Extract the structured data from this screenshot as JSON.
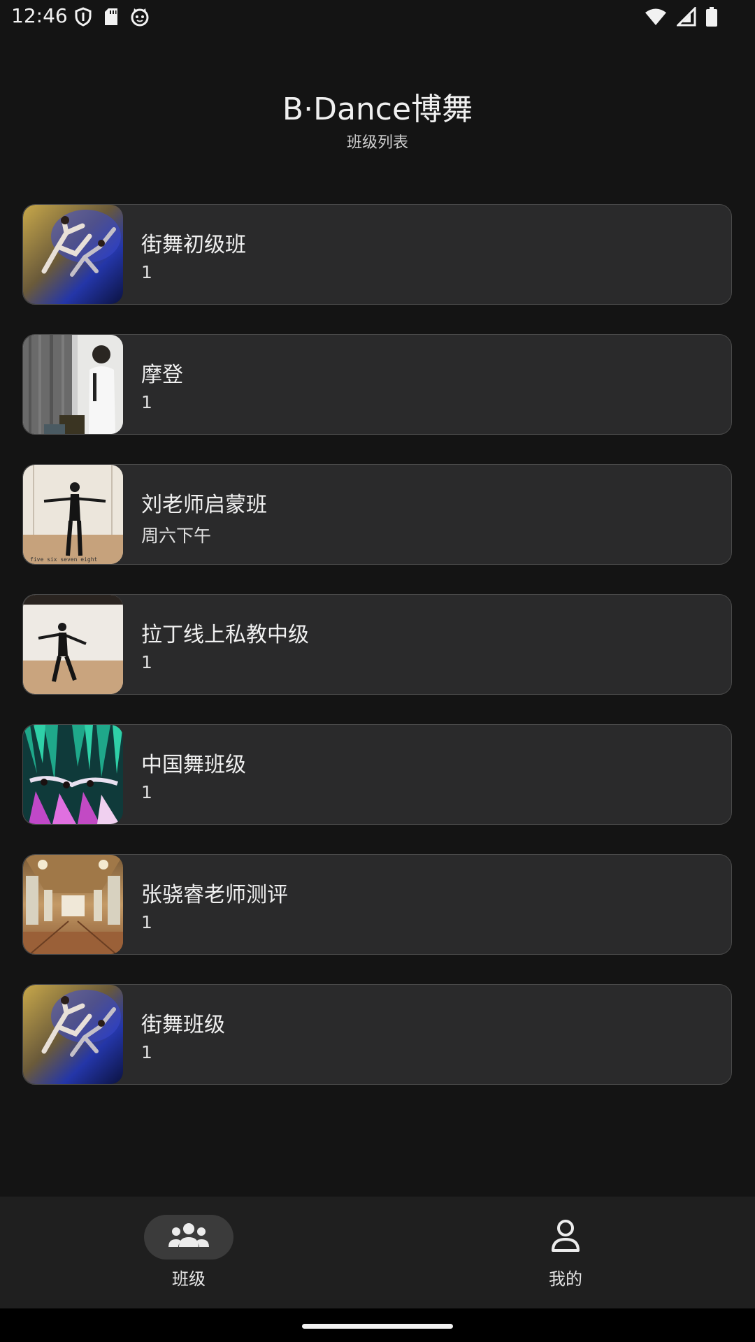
{
  "status_bar": {
    "time": "12:46",
    "left_icons": [
      "shield-icon",
      "sd-card-icon",
      "cat-face-icon"
    ],
    "right_icons": [
      "wifi-icon",
      "signal-icon",
      "battery-icon"
    ]
  },
  "header": {
    "title": "B·Dance博舞",
    "subtitle": "班级列表"
  },
  "classes": [
    {
      "name": "街舞初级班",
      "desc": "1"
    },
    {
      "name": "摩登",
      "desc": "1"
    },
    {
      "name": "刘老师启蒙班",
      "desc": "周六下午"
    },
    {
      "name": "拉丁线上私教中级",
      "desc": "1"
    },
    {
      "name": "中国舞班级",
      "desc": "1"
    },
    {
      "name": "张骁睿老师测评",
      "desc": "1"
    },
    {
      "name": "街舞班级",
      "desc": "1"
    }
  ],
  "bottom_nav": {
    "items": [
      {
        "label": "班级",
        "icon": "group-icon",
        "selected": true
      },
      {
        "label": "我的",
        "icon": "person-icon",
        "selected": false
      }
    ]
  },
  "colors": {
    "background": "#141414",
    "card": "#2a2a2b",
    "card_border": "#4a4a4a",
    "nav_background": "#1f1f1f",
    "nav_selected_pill": "#3b3b3b"
  }
}
